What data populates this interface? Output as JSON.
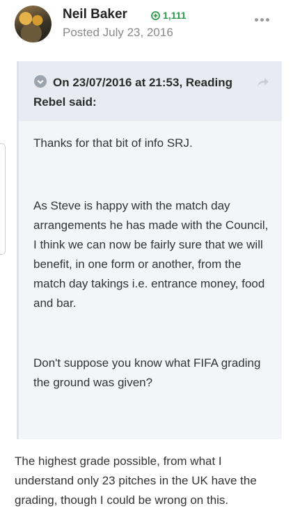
{
  "post": {
    "author": "Neil Baker",
    "reputation": "1,111",
    "posted": "Posted July 23, 2016"
  },
  "quote": {
    "citation": "On 23/07/2016 at 21:53, Reading Rebel said:",
    "paragraphs": [
      "Thanks for that bit of info SRJ.",
      "As Steve is happy with the match day arrangements he has made with the Council, I think we can now be fairly sure that we will benefit, in one form or another, from the match day takings i.e. entrance money, food and bar.",
      "Don't suppose you know what FIFA grading the ground was given?"
    ]
  },
  "reply": {
    "text": "The highest grade possible, from what I understand only 23 pitches in the UK have the grading, though I could be wrong on this."
  },
  "icons": {
    "reputation": "plus-circle-icon",
    "menu": "ellipsis-icon",
    "citation": "chevron-circle-icon",
    "share": "share-arrow-icon"
  },
  "colors": {
    "reputation": "#2e9b4a",
    "quote_bg": "#f3f5f9",
    "quote_header_bg": "#e8ecf2",
    "muted_text": "#8a8a8a"
  }
}
